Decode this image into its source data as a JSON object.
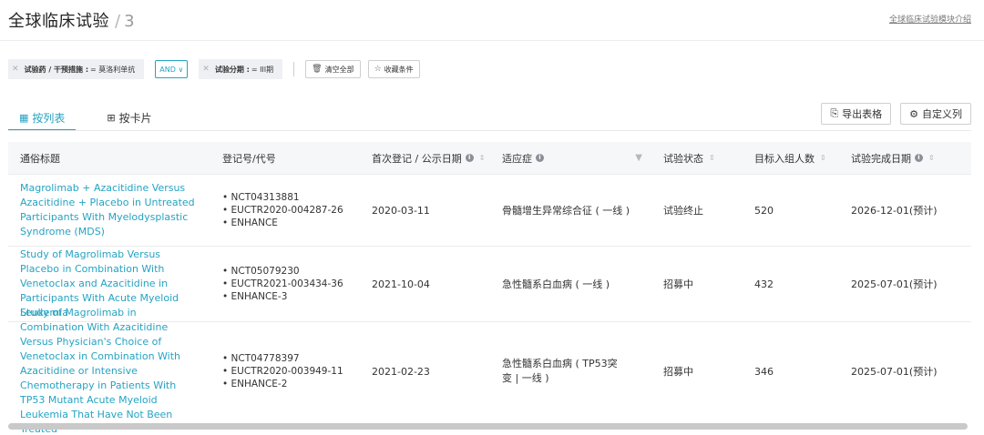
{
  "header": {
    "title": "全球临床试验",
    "separator": "/",
    "count": "3",
    "intro_link": "全球临床试验模块介绍"
  },
  "filters": {
    "chip1": {
      "key": "试验药 / 干预措施 :",
      "value": "= 莫洛利单抗"
    },
    "logic": "AND ∨",
    "chip2": {
      "key": "试验分期 :",
      "value": "= III期"
    },
    "clear_all": "清空全部",
    "save_filter": "收藏条件"
  },
  "tabs": [
    {
      "label": "按列表",
      "icon": "list-icon"
    },
    {
      "label": "按卡片",
      "icon": "grid-icon"
    }
  ],
  "actions": {
    "export": "导出表格",
    "custom_columns": "自定义列"
  },
  "table": {
    "columns": [
      "通俗标题",
      "登记号/代号",
      "首次登记 / 公示日期",
      "适应症",
      "试验状态",
      "目标入组人数",
      "试验完成日期"
    ],
    "rows": [
      {
        "title": "Magrolimab + Azacitidine Versus Azacitidine + Placebo in Untreated Participants With Myelodysplastic Syndrome (MDS)",
        "ids": [
          "• NCT04313881",
          "• EUCTR2020-004287-26",
          "• ENHANCE"
        ],
        "date": "2020-03-11",
        "indication": "骨髓增生异常综合征 ( 一线 )",
        "status": "试验终止",
        "enrollment": "520",
        "completion": "2026-12-01(预计)"
      },
      {
        "title": "Study of Magrolimab Versus Placebo in Combination With Venetoclax and Azacitidine in Participants With Acute Myeloid Leukemia",
        "ids": [
          "• NCT05079230",
          "• EUCTR2021-003434-36",
          "• ENHANCE-3"
        ],
        "date": "2021-10-04",
        "indication": "急性髓系白血病 ( 一线 )",
        "status": "招募中",
        "enrollment": "432",
        "completion": "2025-07-01(预计)"
      },
      {
        "title": "Study of Magrolimab in Combination With Azacitidine Versus Physician's Choice of Venetoclax in Combination With Azacitidine or Intensive Chemotherapy in Patients With TP53 Mutant Acute Myeloid Leukemia That Have Not Been Treated",
        "ids": [
          "• NCT04778397",
          "• EUCTR2020-003949-11",
          "• ENHANCE-2"
        ],
        "date": "2021-02-23",
        "indication": "急性髓系白血病 ( TP53突变 | 一线 )",
        "status": "招募中",
        "enrollment": "346",
        "completion": "2025-07-01(预计)"
      }
    ]
  },
  "colors": {
    "accent": "#25a3c2",
    "header_bg": "#f6f7f9",
    "chip_bg": "#eef0f3"
  }
}
